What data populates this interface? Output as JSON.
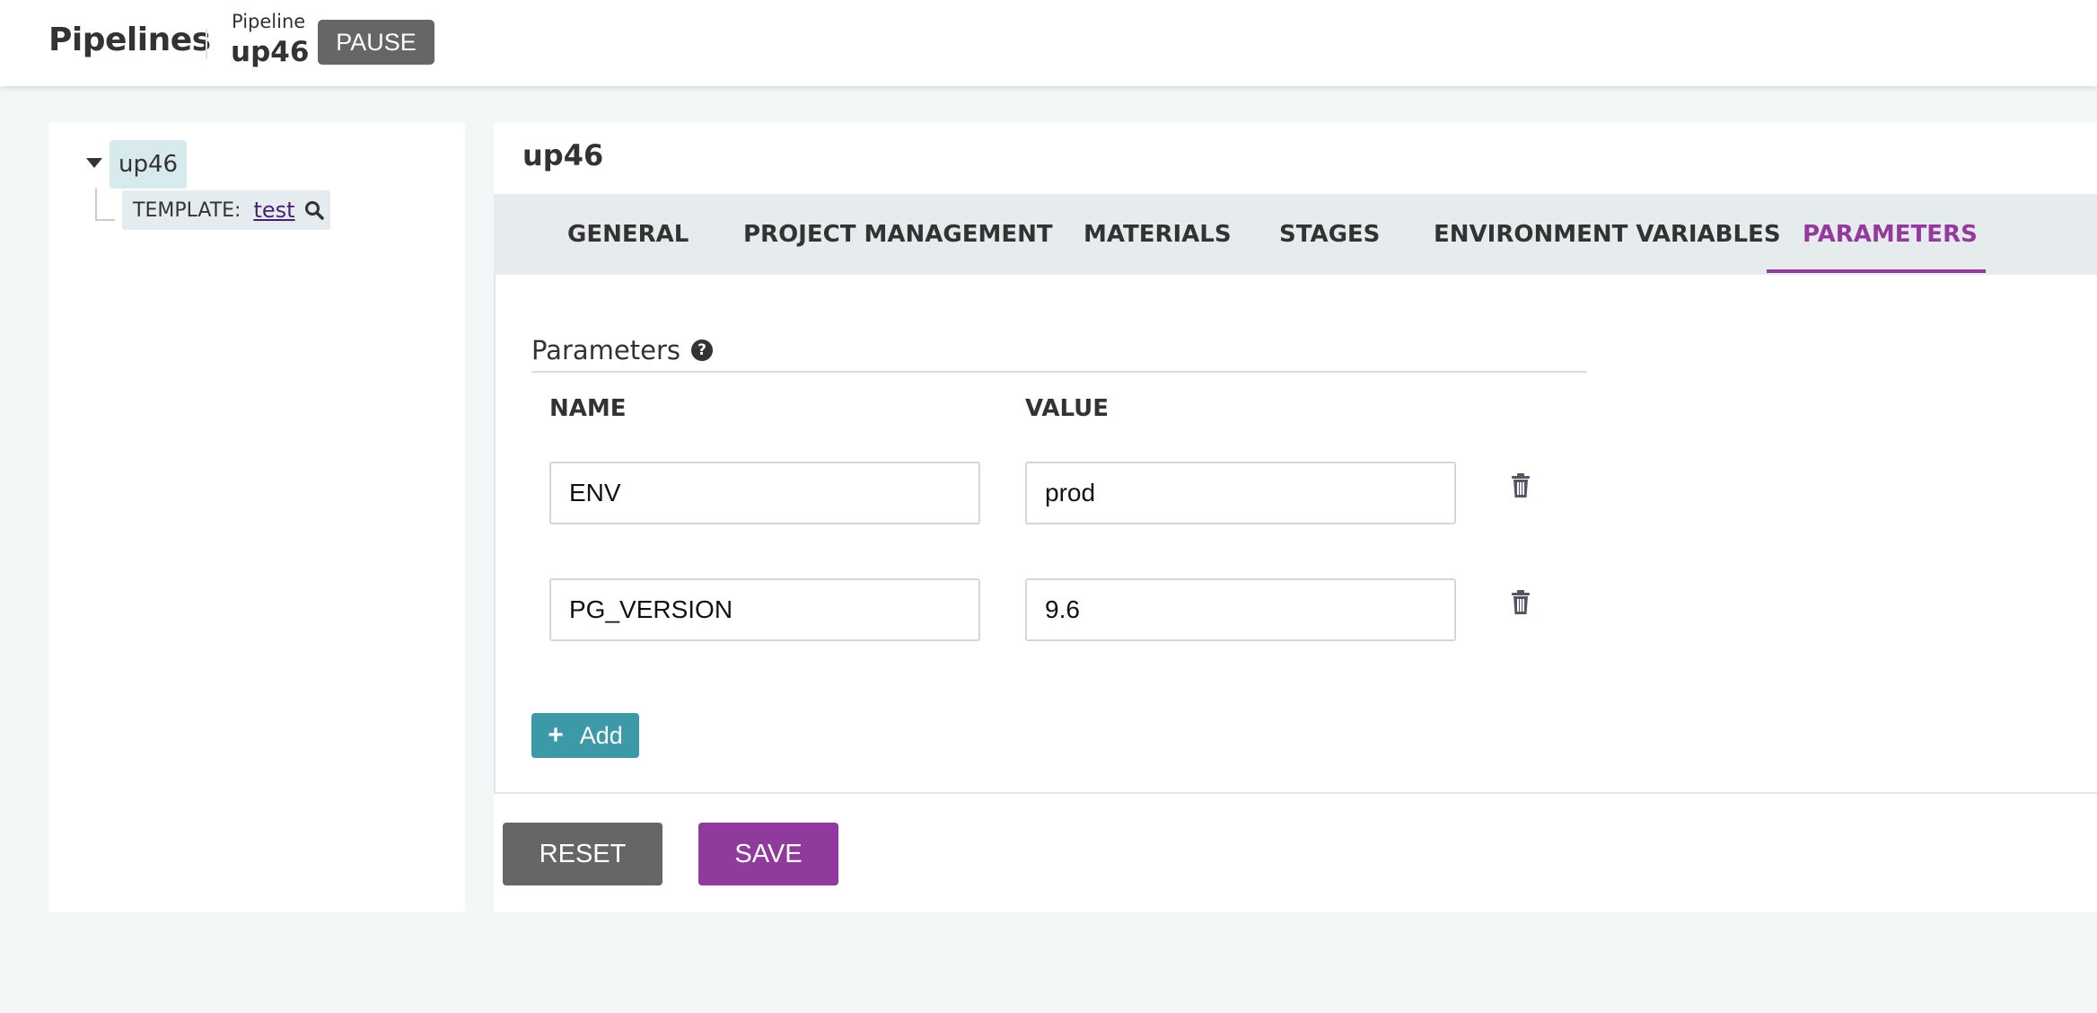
{
  "header": {
    "brand": "Pipelines",
    "pipeline_label": "Pipeline",
    "pipeline_name": "up46",
    "pause_label": "PAUSE"
  },
  "tree": {
    "root_label": "up46",
    "template_label": "TEMPLATE:",
    "template_name": "test"
  },
  "main": {
    "title": "up46",
    "tabs": [
      {
        "label": "GENERAL"
      },
      {
        "label": "PROJECT MANAGEMENT"
      },
      {
        "label": "MATERIALS"
      },
      {
        "label": "STAGES"
      },
      {
        "label": "ENVIRONMENT VARIABLES"
      },
      {
        "label": "PARAMETERS"
      }
    ],
    "active_tab": "PARAMETERS"
  },
  "parameters": {
    "section_title": "Parameters",
    "help_glyph": "?",
    "columns": {
      "name": "NAME",
      "value": "VALUE"
    },
    "rows": [
      {
        "name": "ENV",
        "value": "prod"
      },
      {
        "name": "PG_VERSION",
        "value": "9.6"
      }
    ],
    "add_label": "Add"
  },
  "actions": {
    "reset_label": "RESET",
    "save_label": "SAVE"
  },
  "colors": {
    "accent": "#943a9e",
    "add_button": "#3c9aa8",
    "neutral_button": "#666666"
  },
  "icons": {
    "help": "question-circle-icon",
    "trash": "trash-icon",
    "search": "search-icon",
    "caret": "caret-down-icon",
    "plus": "plus-icon"
  }
}
